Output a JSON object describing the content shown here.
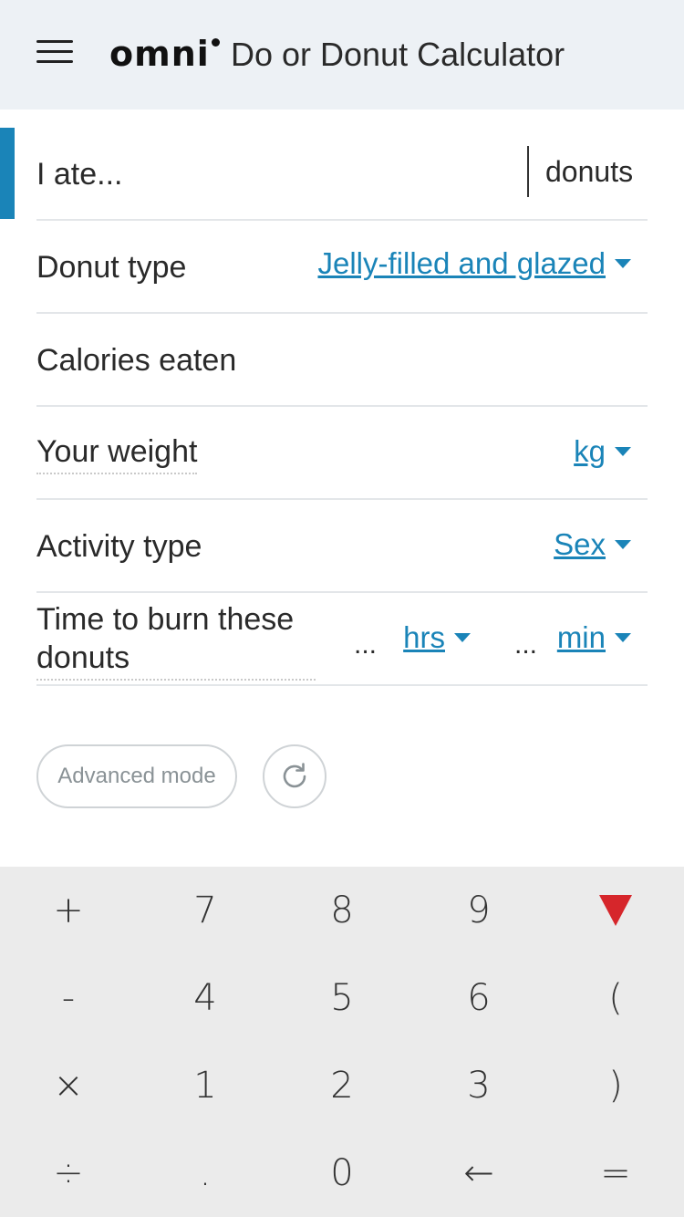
{
  "header": {
    "logo_text": "omni",
    "title": "Do or Donut Calculator"
  },
  "form": {
    "ate": {
      "label": "I ate...",
      "value": "",
      "unit": "donuts"
    },
    "donut_type": {
      "label": "Donut type",
      "selected": "Jelly-filled and glazed"
    },
    "calories": {
      "label": "Calories eaten"
    },
    "weight": {
      "label": "Your weight",
      "unit": "kg"
    },
    "activity": {
      "label": "Activity type",
      "selected": "Sex"
    },
    "time": {
      "label_line1": "Time to burn these",
      "label_line2": "donuts",
      "hrs_value": "...",
      "hrs_unit": "hrs",
      "min_value": "...",
      "min_unit": "min"
    }
  },
  "buttons": {
    "advanced_label": "Advanced mode",
    "refresh_icon": "refresh-icon"
  },
  "keypad": {
    "keys": [
      [
        "+",
        "7",
        "8",
        "9",
        "hide-keyboard"
      ],
      [
        "-",
        "4",
        "5",
        "6",
        "("
      ],
      [
        "×",
        "1",
        "2",
        "3",
        ")"
      ],
      [
        "÷",
        ".",
        "0",
        "←",
        "="
      ]
    ],
    "hide_color": "#d6262b"
  },
  "colors": {
    "accent": "#1a84b8",
    "header_bg": "#edf1f5",
    "keypad_bg": "#ebebeb"
  }
}
